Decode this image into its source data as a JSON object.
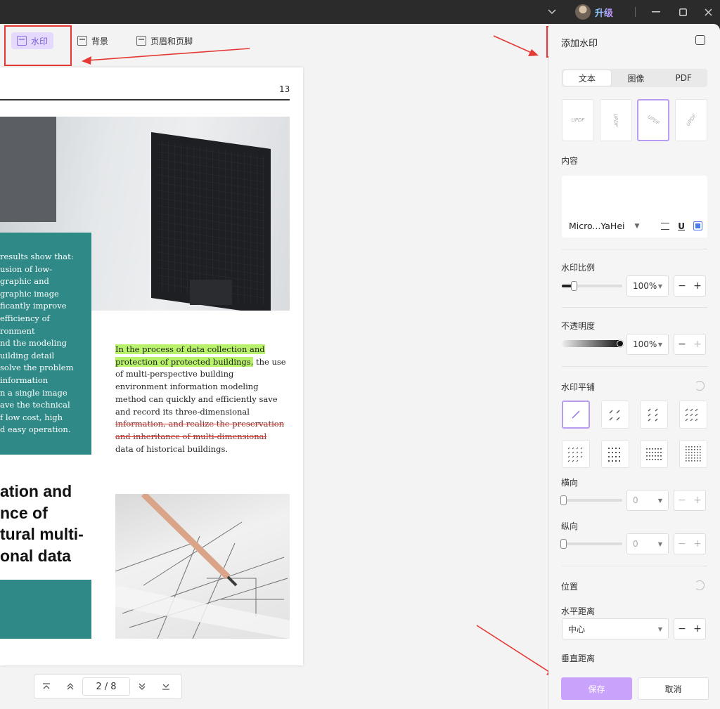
{
  "titlebar": {
    "upgrade_label": "升级"
  },
  "toolbar": {
    "watermark_label": "水印",
    "background_label": "背景",
    "header_footer_label": "页眉和页脚"
  },
  "document": {
    "page_number": "13",
    "teal_lines": [
      "results show that:",
      "usion of low-",
      "graphic and",
      "graphic image",
      "ficantly improve",
      "efficiency of",
      "ronment",
      "nd the modeling",
      "uilding detail",
      "solve the problem",
      " information",
      "n a single image",
      "ave the technical",
      "f low cost, high",
      "d easy operation."
    ],
    "heading_lines": [
      "ation and",
      "nce of",
      "tural multi-",
      "onal data"
    ],
    "para_hl_1": "In the process of data collection and",
    "para_hl_2": "protection of protected buildings,",
    "para_rest_2": " the use",
    "para_lines": [
      "of multi-perspective building",
      "environment information modeling",
      "method can quickly and efficiently save",
      "and record its three-dimensional"
    ],
    "para_strike_1": "information, and realize the preservation",
    "para_strike_2": "and inheritance of multi-dimensional",
    "para_last": "data of historical buildings."
  },
  "pager": {
    "current": "2",
    "separator": "/",
    "total": "8"
  },
  "panel": {
    "title": "添加水印",
    "tabs": [
      "文本",
      "图像",
      "PDF"
    ],
    "active_tab": "文本",
    "preset_sample": "UPDF",
    "content_label": "内容",
    "content_value": "",
    "font_name": "Micro...YaHei",
    "scale_label": "水印比例",
    "scale_value": "100%",
    "scale_fraction": 0.2,
    "opacity_label": "不透明度",
    "opacity_value": "100%",
    "tile_label": "水印平铺",
    "horizontal_label": "横向",
    "horizontal_value": "0",
    "vertical_label": "纵向",
    "vertical_value": "0",
    "position_label": "位置",
    "h_distance_label": "水平距离",
    "h_distance_value": "中心",
    "v_distance_label": "垂直距离",
    "save_label": "保存",
    "cancel_label": "取消"
  },
  "colors": {
    "accent": "#c9a3fb",
    "active_tool_bg": "#e5dafd",
    "teal": "#2f8a87",
    "highlight": "#b8f26a",
    "annotation_red": "#e53935"
  }
}
